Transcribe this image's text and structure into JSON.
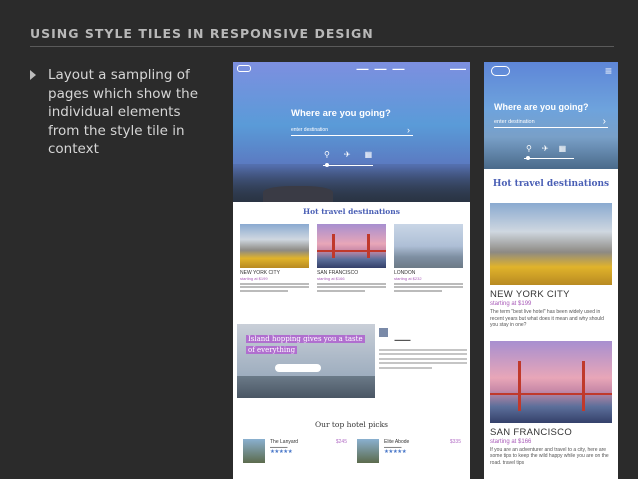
{
  "slide": {
    "title": "USING STYLE TILES IN RESPONSIVE DESIGN",
    "bullet": "Layout a sampling of pages which show the individual elements from the style tile in context"
  },
  "desktop": {
    "hero_question": "Where are you going?",
    "hero_input_placeholder": "enter destination",
    "section_title": "Hot travel destinations",
    "cards": [
      {
        "city": "NEW YORK CITY",
        "price": "starting at $199"
      },
      {
        "city": "SAN FRANCISCO",
        "price": "starting at $166"
      },
      {
        "city": "LONDON",
        "price": "starting at $232"
      }
    ],
    "island_label_1": "Island hopping gives you a taste",
    "island_label_2": "of everything",
    "hotels_title": "Our top hotel picks",
    "hotels": [
      {
        "name": "The Lanyard",
        "stars": "★★★★★",
        "price": "$245"
      },
      {
        "name": "Elite Abode",
        "stars": "★★★★★",
        "price": "$335"
      }
    ]
  },
  "mobile": {
    "hero_question": "Where are you going?",
    "hero_input_placeholder": "enter destination",
    "section_title": "Hot travel destinations",
    "cards": [
      {
        "city": "NEW YORK CITY",
        "price": "starting at $199",
        "text": "The term \"best live hotel\" has been widely used in recent years but what does it mean and why should you stay in one?"
      },
      {
        "city": "SAN FRANCISCO",
        "price": "starting at $166",
        "text": "If you are an adventurer and travel to a city, here are some tips to keep the wild happy while you are on the road. travel tips"
      }
    ]
  },
  "colors": {
    "background": "#2b2b2b",
    "accent_purple": "#a85ab8",
    "accent_blue": "#4a5fb5"
  }
}
